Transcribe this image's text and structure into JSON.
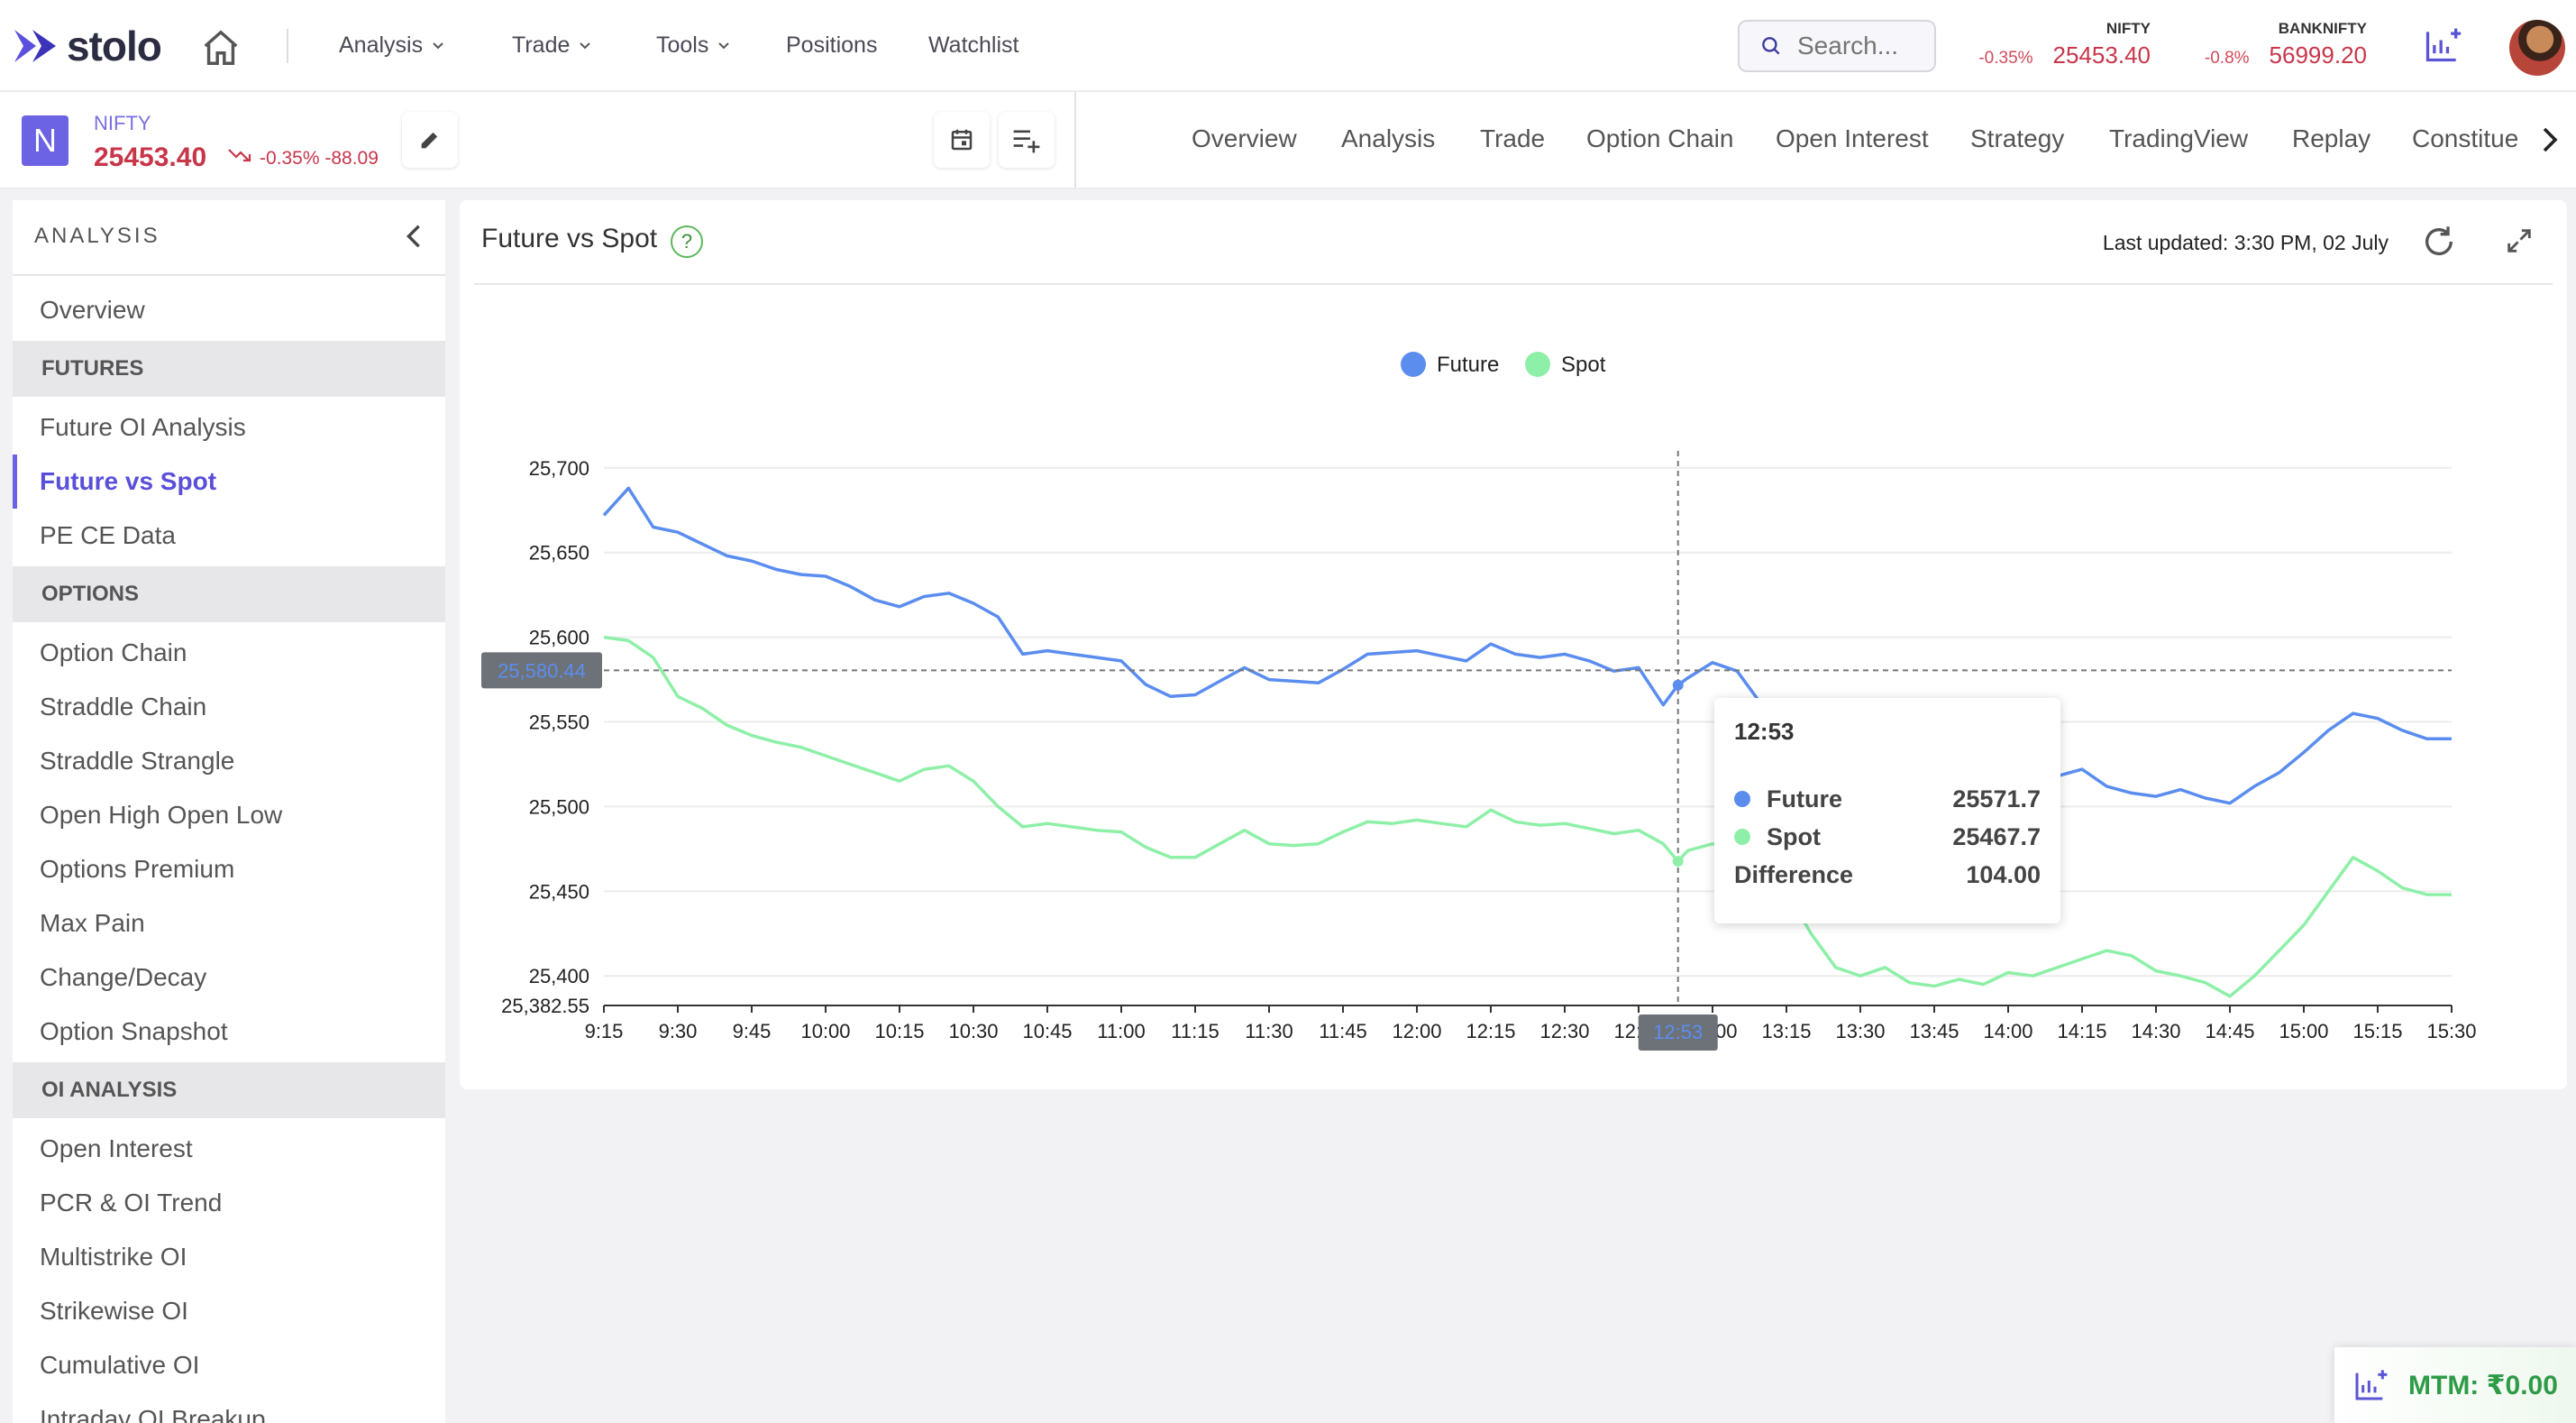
{
  "brand": "stolo",
  "nav": {
    "analysis": "Analysis",
    "trade": "Trade",
    "tools": "Tools",
    "positions": "Positions",
    "watchlist": "Watchlist"
  },
  "search": {
    "placeholder": "Search..."
  },
  "tickers": [
    {
      "name": "NIFTY",
      "change": "-0.35%",
      "value": "25453.40"
    },
    {
      "name": "BANKNIFTY",
      "change": "-0.8%",
      "value": "56999.20"
    }
  ],
  "symbol": {
    "badge": "N",
    "name": "NIFTY",
    "price": "25453.40",
    "change": "-0.35% -88.09"
  },
  "tabs": [
    "Overview",
    "Analysis",
    "Trade",
    "Option Chain",
    "Open Interest",
    "Strategy",
    "TradingView",
    "Replay",
    "Constitue"
  ],
  "sidebar": {
    "title": "ANALYSIS",
    "overview": "Overview",
    "futures": {
      "label": "FUTURES",
      "items": [
        "Future OI Analysis",
        "Future vs Spot",
        "PE CE Data"
      ]
    },
    "options": {
      "label": "OPTIONS",
      "items": [
        "Option Chain",
        "Straddle Chain",
        "Straddle Strangle",
        "Open High Open Low",
        "Options Premium",
        "Max Pain",
        "Change/Decay",
        "Option Snapshot"
      ]
    },
    "oi": {
      "label": "OI ANALYSIS",
      "items": [
        "Open Interest",
        "PCR & OI Trend",
        "Multistrike OI",
        "Strikewise OI",
        "Cumulative OI",
        "Intraday OI Breakup"
      ]
    }
  },
  "card": {
    "title": "Future vs Spot",
    "help": "?",
    "last_updated": "Last updated: 3:30 PM, 02 July"
  },
  "chart_data": {
    "type": "line",
    "ylim": [
      25382.55,
      25710
    ],
    "yticks": [
      25400,
      25450,
      25500,
      25550,
      25600,
      25650,
      25700
    ],
    "ytick_labels": [
      "25,400",
      "25,450",
      "25,500",
      "25,550",
      "25,600",
      "25,650",
      "25,700"
    ],
    "ymin_label": "25,382.55",
    "x_ticks": [
      "9:15",
      "9:30",
      "9:45",
      "10:00",
      "10:15",
      "10:30",
      "10:45",
      "11:00",
      "11:15",
      "11:30",
      "11:45",
      "12:00",
      "12:15",
      "12:30",
      "12:45",
      "13:00",
      "13:15",
      "13:30",
      "13:45",
      "14:00",
      "14:15",
      "14:30",
      "14:45",
      "15:00",
      "15:15",
      "15:30"
    ],
    "colors": {
      "Future": "#5b8def",
      "Spot": "#8ef0a8"
    },
    "x": [
      "9:15",
      "9:20",
      "9:25",
      "9:30",
      "9:35",
      "9:40",
      "9:45",
      "9:50",
      "9:55",
      "10:00",
      "10:05",
      "10:10",
      "10:15",
      "10:20",
      "10:25",
      "10:30",
      "10:35",
      "10:40",
      "10:45",
      "10:50",
      "10:55",
      "11:00",
      "11:05",
      "11:10",
      "11:15",
      "11:20",
      "11:25",
      "11:30",
      "11:35",
      "11:40",
      "11:45",
      "11:50",
      "11:55",
      "12:00",
      "12:05",
      "12:10",
      "12:15",
      "12:20",
      "12:25",
      "12:30",
      "12:35",
      "12:40",
      "12:45",
      "12:50",
      "12:53",
      "12:55",
      "13:00",
      "13:05",
      "13:10",
      "13:15",
      "13:20",
      "13:25",
      "13:30",
      "13:35",
      "13:40",
      "13:45",
      "13:50",
      "13:55",
      "14:00",
      "14:05",
      "14:10",
      "14:15",
      "14:20",
      "14:25",
      "14:30",
      "14:35",
      "14:40",
      "14:45",
      "14:50",
      "14:55",
      "15:00",
      "15:05",
      "15:10",
      "15:15",
      "15:20",
      "15:25",
      "15:30"
    ],
    "series": [
      {
        "name": "Future",
        "values": [
          25672,
          25688,
          25665,
          25662,
          25655,
          25648,
          25645,
          25640,
          25637,
          25636,
          25630,
          25622,
          25618,
          25624,
          25626,
          25620,
          25612,
          25590,
          25592,
          25590,
          25588,
          25586,
          25572,
          25565,
          25566,
          25574,
          25582,
          25575,
          25574,
          25573,
          25581,
          25590,
          25591,
          25592,
          25589,
          25586,
          25596,
          25590,
          25588,
          25590,
          25586,
          25580,
          25582,
          25560,
          25571.7,
          25576,
          25585,
          25580,
          25560,
          25548,
          25538,
          25530,
          25525,
          25520,
          25518,
          25522,
          25526,
          25524,
          25520,
          25515,
          25518,
          25522,
          25512,
          25508,
          25506,
          25510,
          25505,
          25502,
          25512,
          25520,
          25532,
          25545,
          25555,
          25552,
          25545,
          25540,
          25540
        ]
      },
      {
        "name": "Spot",
        "values": [
          25600,
          25598,
          25588,
          25565,
          25558,
          25548,
          25542,
          25538,
          25535,
          25530,
          25525,
          25520,
          25515,
          25522,
          25524,
          25515,
          25500,
          25488,
          25490,
          25488,
          25486,
          25485,
          25476,
          25470,
          25470,
          25478,
          25486,
          25478,
          25477,
          25478,
          25485,
          25491,
          25490,
          25492,
          25490,
          25488,
          25498,
          25491,
          25489,
          25490,
          25487,
          25484,
          25486,
          25478,
          25467.7,
          25474,
          25478,
          25474,
          25462,
          25450,
          25425,
          25405,
          25400,
          25405,
          25396,
          25394,
          25398,
          25395,
          25402,
          25400,
          25405,
          25410,
          25415,
          25412,
          25403,
          25400,
          25396,
          25388,
          25400,
          25415,
          25430,
          25450,
          25470,
          25462,
          25452,
          25448,
          25448
        ]
      }
    ],
    "crosshair": {
      "x": "12:53",
      "y": 25580.44,
      "y_label": "25,580.44"
    },
    "tooltip": {
      "time": "12:53",
      "future_label": "Future",
      "future_value": "25571.7",
      "spot_label": "Spot",
      "spot_value": "25467.7",
      "diff_label": "Difference",
      "diff_value": "104.00"
    },
    "legend_position": "top-center",
    "grid": true
  },
  "mtm": {
    "label": "MTM:  ₹0.00"
  }
}
